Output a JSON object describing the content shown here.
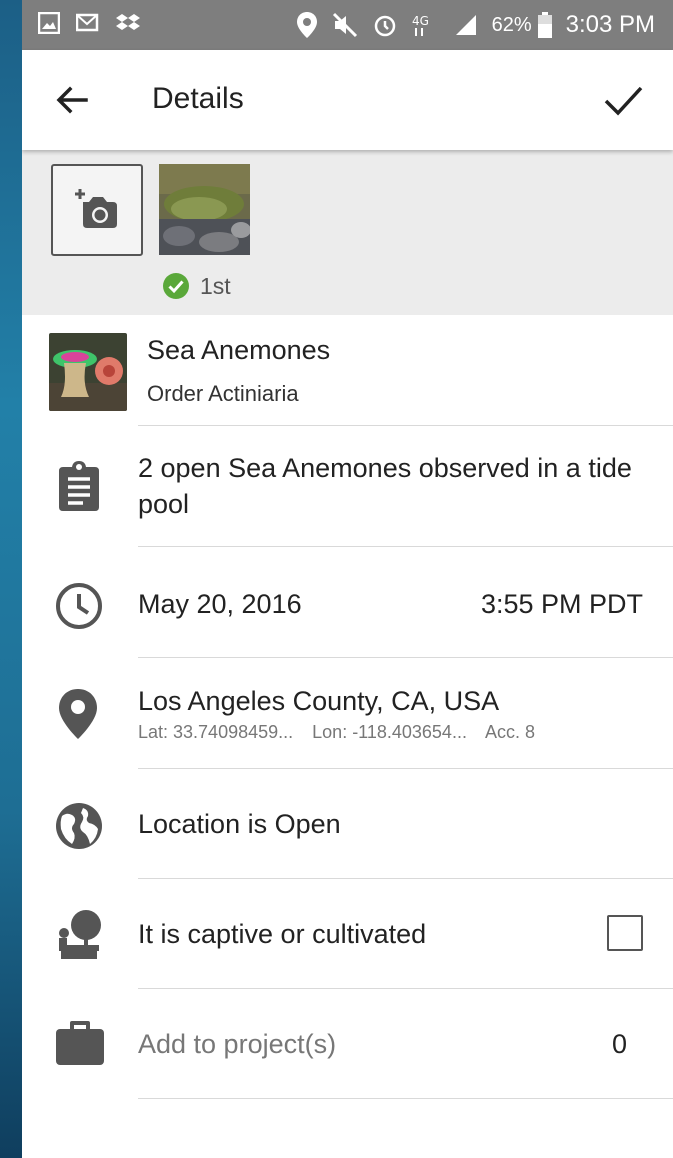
{
  "statusbar": {
    "battery": "62%",
    "time": "3:03 PM"
  },
  "appbar": {
    "title": "Details"
  },
  "photos": {
    "badge_label": "1st"
  },
  "taxon": {
    "common_name": "Sea Anemones",
    "scientific_name": "Order Actiniaria"
  },
  "notes": {
    "text": "2 open Sea Anemones observed in a tide pool"
  },
  "datetime": {
    "date": "May 20, 2016",
    "time": "3:55 PM PDT"
  },
  "location": {
    "place": "Los Angeles County, CA, USA",
    "lat": "Lat: 33.74098459...",
    "lon": "Lon: -118.403654...",
    "acc": "Acc. 8"
  },
  "geoprivacy": {
    "label": "Location is Open"
  },
  "captive": {
    "label": "It is captive or cultivated",
    "checked": false
  },
  "projects": {
    "placeholder": "Add to project(s)",
    "count": "0"
  },
  "colors": {
    "accent_green": "#5aa83a",
    "status_bar": "#7e7e7e",
    "icon_gray": "#555555"
  }
}
